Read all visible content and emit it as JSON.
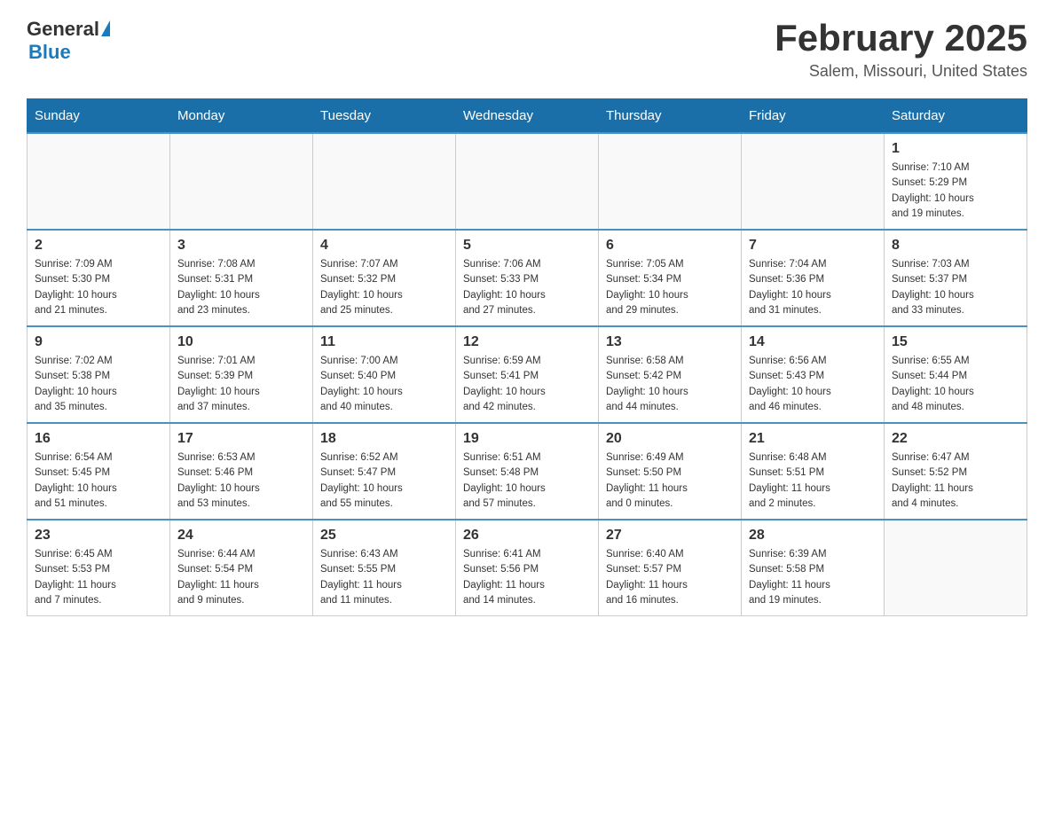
{
  "header": {
    "logo_general": "General",
    "logo_blue": "Blue",
    "title": "February 2025",
    "subtitle": "Salem, Missouri, United States"
  },
  "days_of_week": [
    "Sunday",
    "Monday",
    "Tuesday",
    "Wednesday",
    "Thursday",
    "Friday",
    "Saturday"
  ],
  "weeks": [
    [
      {
        "day": "",
        "info": ""
      },
      {
        "day": "",
        "info": ""
      },
      {
        "day": "",
        "info": ""
      },
      {
        "day": "",
        "info": ""
      },
      {
        "day": "",
        "info": ""
      },
      {
        "day": "",
        "info": ""
      },
      {
        "day": "1",
        "info": "Sunrise: 7:10 AM\nSunset: 5:29 PM\nDaylight: 10 hours\nand 19 minutes."
      }
    ],
    [
      {
        "day": "2",
        "info": "Sunrise: 7:09 AM\nSunset: 5:30 PM\nDaylight: 10 hours\nand 21 minutes."
      },
      {
        "day": "3",
        "info": "Sunrise: 7:08 AM\nSunset: 5:31 PM\nDaylight: 10 hours\nand 23 minutes."
      },
      {
        "day": "4",
        "info": "Sunrise: 7:07 AM\nSunset: 5:32 PM\nDaylight: 10 hours\nand 25 minutes."
      },
      {
        "day": "5",
        "info": "Sunrise: 7:06 AM\nSunset: 5:33 PM\nDaylight: 10 hours\nand 27 minutes."
      },
      {
        "day": "6",
        "info": "Sunrise: 7:05 AM\nSunset: 5:34 PM\nDaylight: 10 hours\nand 29 minutes."
      },
      {
        "day": "7",
        "info": "Sunrise: 7:04 AM\nSunset: 5:36 PM\nDaylight: 10 hours\nand 31 minutes."
      },
      {
        "day": "8",
        "info": "Sunrise: 7:03 AM\nSunset: 5:37 PM\nDaylight: 10 hours\nand 33 minutes."
      }
    ],
    [
      {
        "day": "9",
        "info": "Sunrise: 7:02 AM\nSunset: 5:38 PM\nDaylight: 10 hours\nand 35 minutes."
      },
      {
        "day": "10",
        "info": "Sunrise: 7:01 AM\nSunset: 5:39 PM\nDaylight: 10 hours\nand 37 minutes."
      },
      {
        "day": "11",
        "info": "Sunrise: 7:00 AM\nSunset: 5:40 PM\nDaylight: 10 hours\nand 40 minutes."
      },
      {
        "day": "12",
        "info": "Sunrise: 6:59 AM\nSunset: 5:41 PM\nDaylight: 10 hours\nand 42 minutes."
      },
      {
        "day": "13",
        "info": "Sunrise: 6:58 AM\nSunset: 5:42 PM\nDaylight: 10 hours\nand 44 minutes."
      },
      {
        "day": "14",
        "info": "Sunrise: 6:56 AM\nSunset: 5:43 PM\nDaylight: 10 hours\nand 46 minutes."
      },
      {
        "day": "15",
        "info": "Sunrise: 6:55 AM\nSunset: 5:44 PM\nDaylight: 10 hours\nand 48 minutes."
      }
    ],
    [
      {
        "day": "16",
        "info": "Sunrise: 6:54 AM\nSunset: 5:45 PM\nDaylight: 10 hours\nand 51 minutes."
      },
      {
        "day": "17",
        "info": "Sunrise: 6:53 AM\nSunset: 5:46 PM\nDaylight: 10 hours\nand 53 minutes."
      },
      {
        "day": "18",
        "info": "Sunrise: 6:52 AM\nSunset: 5:47 PM\nDaylight: 10 hours\nand 55 minutes."
      },
      {
        "day": "19",
        "info": "Sunrise: 6:51 AM\nSunset: 5:48 PM\nDaylight: 10 hours\nand 57 minutes."
      },
      {
        "day": "20",
        "info": "Sunrise: 6:49 AM\nSunset: 5:50 PM\nDaylight: 11 hours\nand 0 minutes."
      },
      {
        "day": "21",
        "info": "Sunrise: 6:48 AM\nSunset: 5:51 PM\nDaylight: 11 hours\nand 2 minutes."
      },
      {
        "day": "22",
        "info": "Sunrise: 6:47 AM\nSunset: 5:52 PM\nDaylight: 11 hours\nand 4 minutes."
      }
    ],
    [
      {
        "day": "23",
        "info": "Sunrise: 6:45 AM\nSunset: 5:53 PM\nDaylight: 11 hours\nand 7 minutes."
      },
      {
        "day": "24",
        "info": "Sunrise: 6:44 AM\nSunset: 5:54 PM\nDaylight: 11 hours\nand 9 minutes."
      },
      {
        "day": "25",
        "info": "Sunrise: 6:43 AM\nSunset: 5:55 PM\nDaylight: 11 hours\nand 11 minutes."
      },
      {
        "day": "26",
        "info": "Sunrise: 6:41 AM\nSunset: 5:56 PM\nDaylight: 11 hours\nand 14 minutes."
      },
      {
        "day": "27",
        "info": "Sunrise: 6:40 AM\nSunset: 5:57 PM\nDaylight: 11 hours\nand 16 minutes."
      },
      {
        "day": "28",
        "info": "Sunrise: 6:39 AM\nSunset: 5:58 PM\nDaylight: 11 hours\nand 19 minutes."
      },
      {
        "day": "",
        "info": ""
      }
    ]
  ]
}
